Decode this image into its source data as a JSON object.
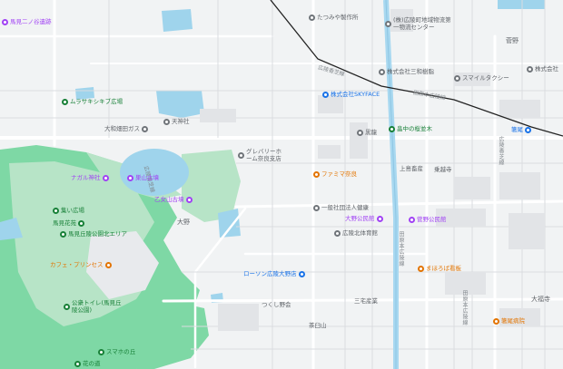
{
  "colors": {
    "park": "#b7e4c7",
    "park_dark": "#7ed8a5",
    "water": "#9fd4ec",
    "road_main": "#ffffff",
    "canal": "#a8d8f0",
    "rail": "#222222",
    "land": "#f1f3f4",
    "poi_green": "#188038",
    "poi_orange": "#e37400",
    "poi_purple": "#a142f4",
    "poi_blue": "#1a73e8",
    "poi_gray": "#70757a"
  },
  "pois": [
    {
      "label": "馬見二ノ谷遺跡",
      "icon": "shrine-pin-icon",
      "color": "purple"
    },
    {
      "label": "たつみや製作所",
      "icon": "business-pin-icon",
      "color": "gray"
    },
    {
      "label": "(株)広陵町地域物流第一物流センター",
      "icon": "business-pin-icon",
      "color": "gray"
    },
    {
      "label": "株式会社三和樹脂",
      "icon": "business-pin-icon",
      "color": "gray"
    },
    {
      "label": "スマイルタクシー",
      "icon": "business-pin-icon",
      "color": "gray"
    },
    {
      "label": "株式会社",
      "icon": "business-pin-icon",
      "color": "gray"
    },
    {
      "label": "株式会社SKYFACE",
      "icon": "building-pin-icon",
      "color": "blue"
    },
    {
      "label": "ムラサキシキブ広場",
      "icon": "park-pin-icon",
      "color": "green"
    },
    {
      "label": "大和畑田ガス",
      "icon": "business-pin-icon",
      "color": "gray"
    },
    {
      "label": "天神社",
      "icon": "shrine-pin-icon",
      "color": "gray"
    },
    {
      "label": "黒龍",
      "icon": "shrine-pin-icon",
      "color": "gray"
    },
    {
      "label": "畠中の桜並木",
      "icon": "park-pin-icon",
      "color": "green"
    },
    {
      "label": "グレバリーホーム奈良支店",
      "icon": "business-pin-icon",
      "color": "gray"
    },
    {
      "label": "ファミマ奈良",
      "icon": "store-pin-icon",
      "color": "orange"
    },
    {
      "label": "上島畜産",
      "icon": "business-pin-icon",
      "color": "gray"
    },
    {
      "label": "乗越寺",
      "icon": "shrine-pin-icon",
      "color": "gray"
    },
    {
      "label": "ナガル神社",
      "icon": "shrine-pin-icon",
      "color": "purple"
    },
    {
      "label": "巣山古墳",
      "icon": "shrine-pin-icon",
      "color": "purple"
    },
    {
      "label": "乙女山古墳",
      "icon": "shrine-pin-icon",
      "color": "purple"
    },
    {
      "label": "一般社団法人健康",
      "icon": "business-pin-icon",
      "color": "gray"
    },
    {
      "label": "大野公民館",
      "icon": "civic-pin-icon",
      "color": "purple"
    },
    {
      "label": "菅野公民館",
      "icon": "civic-pin-icon",
      "color": "purple"
    },
    {
      "label": "集い広場",
      "icon": "park-pin-icon",
      "color": "green"
    },
    {
      "label": "馬見花苑",
      "icon": "park-pin-icon",
      "color": "green"
    },
    {
      "label": "馬見丘陵公園北エリア",
      "icon": "park-pin-icon",
      "color": "green"
    },
    {
      "label": "広陵北体育館",
      "icon": "business-pin-icon",
      "color": "gray"
    },
    {
      "label": "カフェ・プリンセス",
      "icon": "cafe-pin-icon",
      "color": "orange"
    },
    {
      "label": "公衆トイレ(馬見丘陵公園)",
      "icon": "park-pin-icon",
      "color": "green"
    },
    {
      "label": "ローソン広陵大野店",
      "icon": "store-pin-icon",
      "color": "blue"
    },
    {
      "label": "三宅産業",
      "icon": "business-pin-icon",
      "color": "gray"
    },
    {
      "label": "まほろば看板",
      "icon": "store-pin-icon",
      "color": "orange"
    },
    {
      "label": "箸尾病院",
      "icon": "hospital-pin-icon",
      "color": "orange"
    },
    {
      "label": "つくし野会",
      "icon": "business-pin-icon",
      "color": "gray"
    },
    {
      "label": "スマホの丘",
      "icon": "park-pin-icon",
      "color": "green"
    },
    {
      "label": "花の道",
      "icon": "park-pin-icon",
      "color": "green"
    },
    {
      "label": "茶臼山",
      "icon": "business-pin-icon",
      "color": "gray"
    },
    {
      "label": "箸尾",
      "icon": "train-station-icon",
      "color": "blue"
    }
  ],
  "areas": [
    {
      "label": "大野"
    },
    {
      "label": "菅野"
    },
    {
      "label": "大福寺"
    }
  ],
  "roads": [
    {
      "label": "広陵香芝線"
    },
    {
      "label": "田原本広陵線"
    }
  ]
}
